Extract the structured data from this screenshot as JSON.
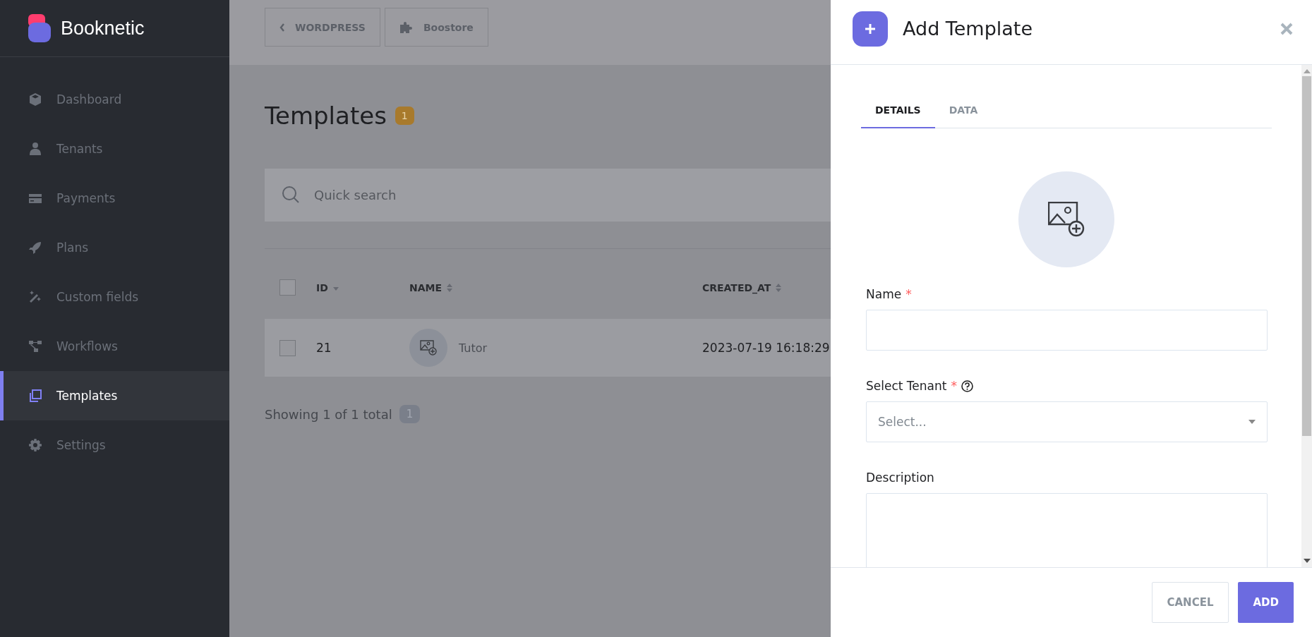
{
  "sidebar": {
    "brand": "Booknetic",
    "items": [
      {
        "label": "Dashboard",
        "selected": false
      },
      {
        "label": "Tenants",
        "selected": false
      },
      {
        "label": "Payments",
        "selected": false
      },
      {
        "label": "Plans",
        "selected": false
      },
      {
        "label": "Custom fields",
        "selected": false
      },
      {
        "label": "Workflows",
        "selected": false
      },
      {
        "label": "Templates",
        "selected": true
      },
      {
        "label": "Settings",
        "selected": false
      }
    ]
  },
  "top_bar": {
    "buttons": [
      {
        "label": "WORDPRESS"
      },
      {
        "label": "Boostore"
      }
    ]
  },
  "page": {
    "title": "Templates",
    "count": "1"
  },
  "search": {
    "placeholder": "Quick search"
  },
  "table": {
    "select_all_checked": false,
    "columns": [
      {
        "label": "ID",
        "sorted": true
      },
      {
        "label": "NAME",
        "sorted": false
      },
      {
        "label": "CREATED_AT",
        "sorted": false
      }
    ],
    "rows": [
      {
        "id": "21",
        "name": "Tutor",
        "created_at": "2023-07-19 16:18:29",
        "checked": false
      }
    ]
  },
  "footer": {
    "text": "Showing 1 of 1 total",
    "count": "1"
  },
  "panel": {
    "title": "Add Template",
    "tabs": [
      {
        "label": "DETAILS",
        "selected": true
      },
      {
        "label": "DATA",
        "selected": false
      }
    ],
    "fields": [
      {
        "kind": "text",
        "label": "Name",
        "required_mark": "*"
      },
      {
        "kind": "select",
        "label": "Select Tenant",
        "required_mark": "*",
        "help": true,
        "placeholder": "Select..."
      },
      {
        "kind": "textarea",
        "label": "Description"
      }
    ],
    "buttons": [
      {
        "label": "CANCEL",
        "kind": "secondary"
      },
      {
        "label": "ADD",
        "kind": "primary"
      }
    ]
  }
}
